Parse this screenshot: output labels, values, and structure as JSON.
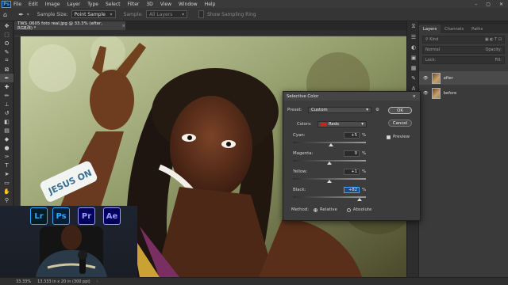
{
  "menubar": {
    "logo": "Ps",
    "items": [
      "File",
      "Edit",
      "Image",
      "Layer",
      "Type",
      "Select",
      "Filter",
      "3D",
      "View",
      "Window",
      "Help"
    ],
    "window_buttons": [
      "–",
      "▢",
      "✕"
    ]
  },
  "options": {
    "sample_size_label": "Sample Size:",
    "sample_size_value": "Point Sample",
    "sample_label": "Sample:",
    "sample_value": "All Layers",
    "show_ring_label": "Show Sampling Ring"
  },
  "document": {
    "tab_title": "TWS_0605 foto real.jpg @ 33.3% (after, RGB/8) *",
    "tab_close": "×"
  },
  "photo": {
    "wristband_text": "JESUS ON"
  },
  "status": {
    "zoom": "33.33%",
    "dimensions": "13.333 in x 20 in (300 ppi)"
  },
  "layers_panel": {
    "tabs": [
      "Layers",
      "Channels",
      "Paths"
    ],
    "kind_label": "Kind",
    "blend_mode": "Normal",
    "opacity_label": "Opacity:",
    "lock_label": "Lock:",
    "fill_label": "Fill:",
    "layers": [
      {
        "name": "after",
        "visible": true
      },
      {
        "name": "before",
        "visible": true
      }
    ]
  },
  "dialog": {
    "title": "Selective Color",
    "close": "×",
    "preset_label": "Preset:",
    "preset_value": "Custom",
    "colors_label": "Colors:",
    "colors_value": "Reds",
    "colors_swatch": "#c0281e",
    "sliders": [
      {
        "label": "Cyan:",
        "value": "+5",
        "unit": "%",
        "percent": 5
      },
      {
        "label": "Magenta:",
        "value": "0",
        "unit": "%",
        "percent": 0
      },
      {
        "label": "Yellow:",
        "value": "+1",
        "unit": "%",
        "percent": 1
      },
      {
        "label": "Black:",
        "value": "+82",
        "unit": "%",
        "percent": 82
      }
    ],
    "ok_label": "OK",
    "cancel_label": "Cancel",
    "preview_label": "Preview",
    "method_label": "Method:",
    "relative_label": "Relative",
    "absolute_label": "Absolute"
  },
  "webcam": {
    "apps": [
      {
        "name": "Lr",
        "bg": "#001d26",
        "fg": "#31a8ff"
      },
      {
        "name": "Ps",
        "bg": "#001e36",
        "fg": "#31a8ff"
      },
      {
        "name": "Pr",
        "bg": "#00005b",
        "fg": "#9999ff"
      },
      {
        "name": "Ae",
        "bg": "#00005b",
        "fg": "#9999ff"
      }
    ]
  },
  "colors": {
    "accent": "#31a8ff",
    "dialog_bg": "#3c3c3c",
    "app_bg": "#282828"
  }
}
